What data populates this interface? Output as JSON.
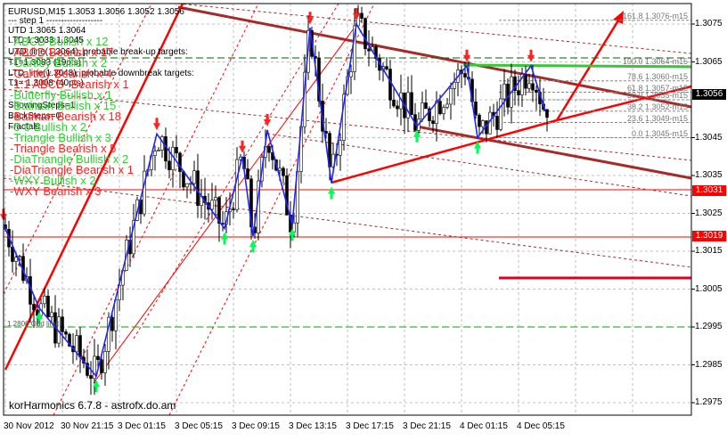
{
  "chart": {
    "info_lines": [
      "EURUSD,M15  1.3053 1.3056 1.3052 1.3056",
      "---    step 1    -------------------",
      "UTD 1.3065  1.3064",
      "LTD 1.3033  1.3045",
      "UTD_line(1.3064), probable break-up targets:",
      "T1=1.3083 (19pts)",
      "LTD_line(1.3048), probable downbreak targets:",
      "T1= 1.3008 (40pts)",
      "ShowingSteps=1",
      "BackSteps=0",
      "Fractals"
    ],
    "patterns": [
      {
        "text": "-ABCD Bullish x 12",
        "color": "#33cc33"
      },
      {
        "text": "-ABCD Bearish x 17",
        "color": "#ff2222"
      },
      {
        "text": "-Gartley Bullish x 2",
        "color": "#33cc33"
      },
      {
        "text": "-Gartley Bearish x 4",
        "color": "#ff2222"
      },
      {
        "text": "-1:1 ABCD_Bearish x 1",
        "color": "#ff2222"
      },
      {
        "text": "-Butterfly Bullish x 1",
        "color": "#33cc33"
      },
      {
        "text": "-Batman Bullish x 15",
        "color": "#33cc33"
      },
      {
        "text": "-Batman Bearish x 18",
        "color": "#ff2222"
      },
      {
        "text": "-5-0 Bullish x 2",
        "color": "#33cc33"
      },
      {
        "text": "-Triangle Bullish x 3",
        "color": "#33cc33"
      },
      {
        "text": "-Triangle Bearish x 5",
        "color": "#ff2222"
      },
      {
        "text": "-DiaTriangle Bullish x 2",
        "color": "#33cc33"
      },
      {
        "text": "-DiaTriangle Bearish x 1",
        "color": "#ff2222"
      },
      {
        "text": "-WXY Bullish x 2",
        "color": "#33cc33"
      },
      {
        "text": "-WXY Bearish x 3",
        "color": "#ff2222"
      }
    ],
    "watermark": "korHarmonics 6.7.8 - astrofx.do.am",
    "small_label": "1.2806 Odd limit",
    "price_axis": [
      "1.3075",
      "1.3065",
      "1.3045",
      "1.3035",
      "1.3025",
      "1.3015",
      "1.3005",
      "1.2995",
      "1.2985",
      "1.2975"
    ],
    "current_price": "1.3056",
    "level_boxes": [
      {
        "price": "1.3031",
        "color": "#ff0000"
      },
      {
        "price": "1.3019",
        "color": "#ff0000"
      }
    ],
    "time_axis": [
      "30 Nov 2012",
      "30 Nov 21:15",
      "3 Dec 01:15",
      "3 Dec 05:15",
      "3 Dec 09:15",
      "3 Dec 13:15",
      "3 Dec 17:15",
      "3 Dec 21:15",
      "4 Dec 01:15",
      "4 Dec 05:15"
    ],
    "fib_levels": [
      {
        "label": "161.8 1.3076-m15",
        "price": 1.3076
      },
      {
        "label": "100.0 1.3064-m15",
        "price": 1.3064
      },
      {
        "label": "78.6 1.3060-m15",
        "price": 1.306
      },
      {
        "label": "61.8 1.3057-m15",
        "price": 1.3057
      },
      {
        "label": "50.0 1.3055-m15",
        "price": 1.3055
      },
      {
        "label": "38.2 1.3052-m15",
        "price": 1.3052
      },
      {
        "label": "23.6 1.3049-m15",
        "price": 1.3049
      },
      {
        "label": "0.0 1.3045-m15",
        "price": 1.3045
      }
    ],
    "colors": {
      "bull": "#00ff55",
      "bear": "#ff2222",
      "zigzag": "#2222ff",
      "channel": "#a52a2a",
      "green_level": "#33cc33"
    }
  },
  "chart_data": {
    "type": "candlestick",
    "symbol": "EURUSD,M15",
    "ylim": [
      1.297,
      1.3082
    ],
    "zigzag": [
      {
        "t": "30 Nov 17:15",
        "p": 1.3022
      },
      {
        "t": "30 Nov 19:45",
        "p": 1.3
      },
      {
        "t": "30 Nov 23:45",
        "p": 1.2982
      },
      {
        "t": "3 Dec 04:00",
        "p": 1.3046
      },
      {
        "t": "3 Dec 08:45",
        "p": 1.3021
      },
      {
        "t": "3 Dec 10:00",
        "p": 1.304
      },
      {
        "t": "3 Dec 10:45",
        "p": 1.3019
      },
      {
        "t": "3 Dec 11:45",
        "p": 1.3047
      },
      {
        "t": "3 Dec 13:30",
        "p": 1.3022
      },
      {
        "t": "3 Dec 14:45",
        "p": 1.3074
      },
      {
        "t": "3 Dec 16:15",
        "p": 1.3033
      },
      {
        "t": "3 Dec 18:00",
        "p": 1.3075
      },
      {
        "t": "3 Dec 22:15",
        "p": 1.3048
      },
      {
        "t": "4 Dec 01:45",
        "p": 1.3064
      },
      {
        "t": "4 Dec 02:30",
        "p": 1.3045
      },
      {
        "t": "4 Dec 06:15",
        "p": 1.3064
      },
      {
        "t": "4 Dec 07:15",
        "p": 1.3052
      },
      {
        "t": "4 Dec 07:30",
        "p": 1.3056
      }
    ],
    "horizontal_levels": [
      1.3064,
      1.3031,
      1.3019,
      1.3008,
      1.2995
    ]
  }
}
